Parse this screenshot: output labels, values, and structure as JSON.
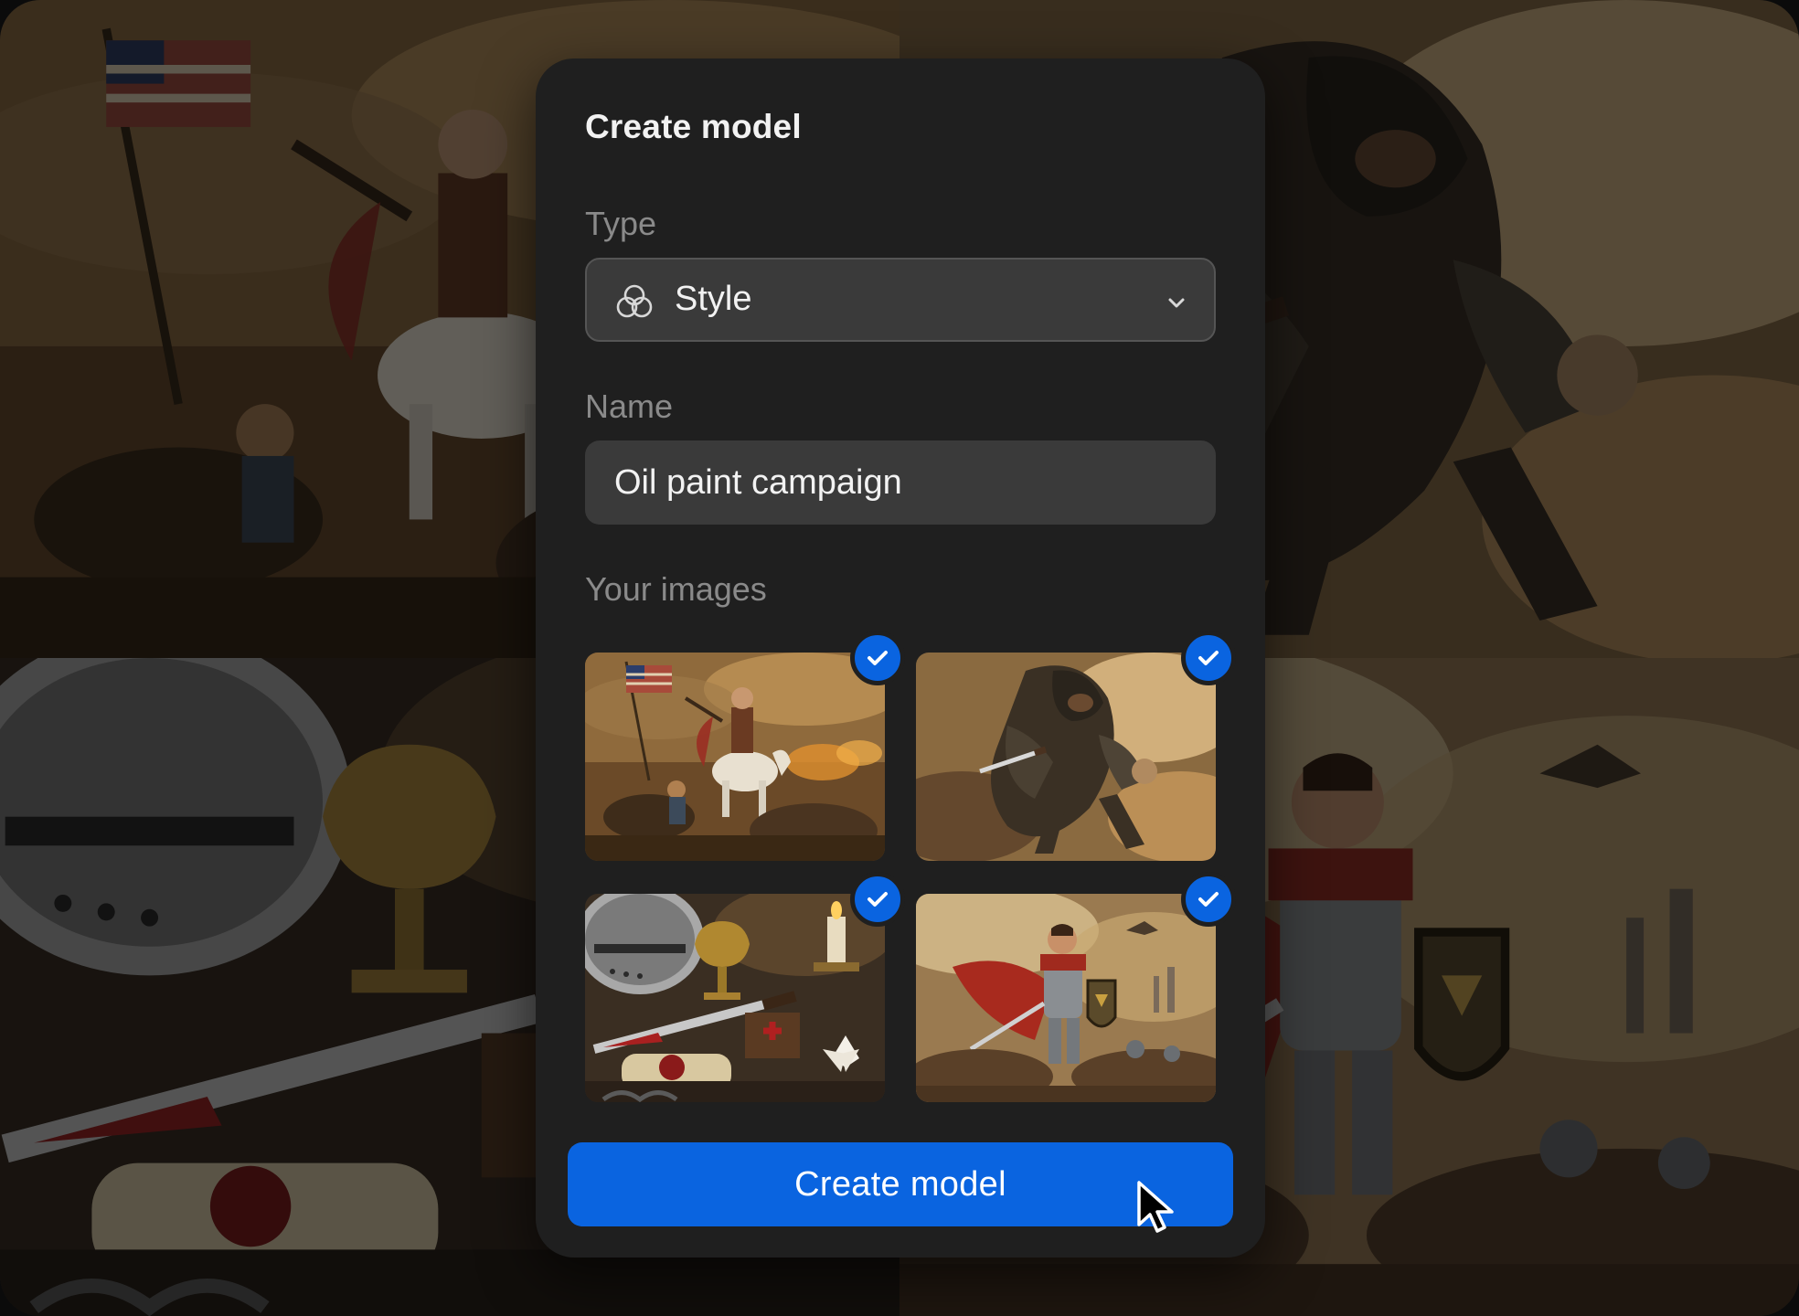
{
  "modal": {
    "title": "Create model",
    "type_label": "Type",
    "type_value": "Style",
    "type_icon": "style-rings-icon",
    "name_label": "Name",
    "name_value": "Oil paint campaign",
    "images_label": "Your images",
    "images": [
      {
        "subject": "revolutionary-war-cavalry-painting",
        "selected": true
      },
      {
        "subject": "hooded-rogue-dagger-painting",
        "selected": true
      },
      {
        "subject": "crusader-helmet-still-life-painting",
        "selected": true
      },
      {
        "subject": "knight-with-shield-painting",
        "selected": true
      }
    ],
    "submit_label": "Create model"
  },
  "colors": {
    "accent": "#0a64e0",
    "modal_bg": "#1f1f1f",
    "field_bg": "#3a3a3a"
  }
}
